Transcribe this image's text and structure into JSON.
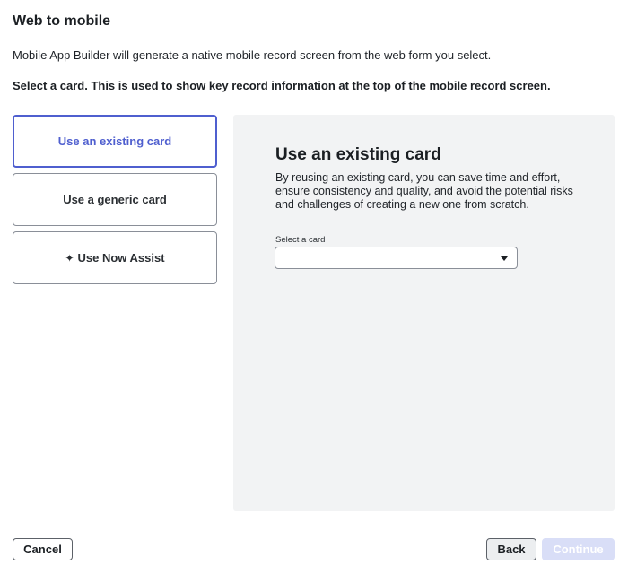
{
  "header": {
    "title": "Web to mobile",
    "intro": "Mobile App Builder will generate a native mobile record screen from the web form you select.",
    "instruction": "Select a card. This is used to show key record information at the top of the mobile record screen."
  },
  "options": {
    "existing": "Use an existing card",
    "generic": "Use a generic card",
    "now_assist": "Use Now Assist",
    "now_assist_icon": "sparkle-icon",
    "selected": "existing"
  },
  "panel": {
    "title": "Use an existing card",
    "description": "By reusing an existing card, you can save time and effort, ensure consistency and quality, and avoid the potential risks and challenges of creating a new one from scratch.",
    "select_label": "Select a card",
    "select_value": ""
  },
  "footer": {
    "cancel": "Cancel",
    "back": "Back",
    "continue": "Continue",
    "continue_disabled": true
  },
  "colors": {
    "accent": "#4f5fcf",
    "continue_disabled_bg": "#d9def7",
    "panel_bg": "#f2f3f4"
  }
}
